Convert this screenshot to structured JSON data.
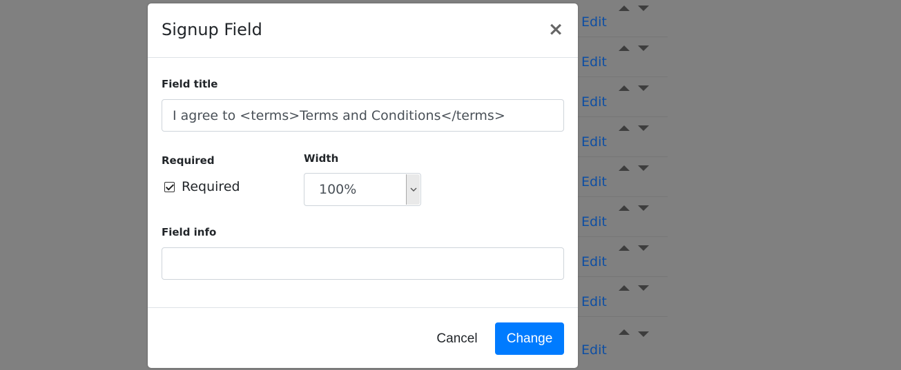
{
  "background": {
    "rows": [
      {
        "edit_label": "Edit"
      },
      {
        "edit_label": "Edit"
      },
      {
        "edit_label": "Edit"
      },
      {
        "edit_label": "Edit"
      },
      {
        "edit_label": "Edit"
      },
      {
        "edit_label": "Edit"
      },
      {
        "edit_label": "Edit"
      },
      {
        "edit_label": "Edit"
      },
      {
        "edit_label": "Edit"
      }
    ]
  },
  "modal": {
    "title": "Signup Field",
    "close_symbol": "×",
    "field_title_label": "Field title",
    "field_title_value": "I agree to <terms>Terms and Conditions</terms>",
    "required_label": "Required",
    "required_checkbox_label": "Required",
    "required_checked": true,
    "width_label": "Width",
    "width_value": "100%",
    "field_info_label": "Field info",
    "field_info_value": "",
    "cancel_label": "Cancel",
    "change_label": "Change"
  },
  "colors": {
    "primary": "#007bff",
    "link": "#0d4ea3",
    "overlay": "#808080"
  },
  "icons": {
    "close": "close-icon",
    "caret": "chevron-down-icon",
    "up": "arrow-up-icon",
    "down": "arrow-down-icon",
    "check": "check-icon"
  }
}
